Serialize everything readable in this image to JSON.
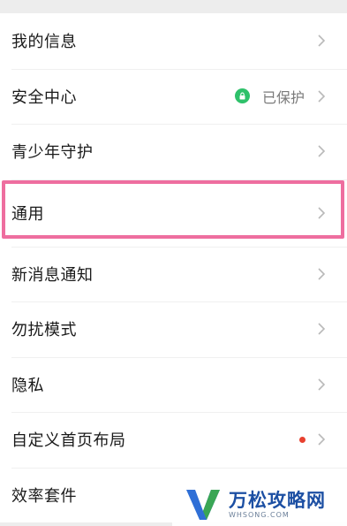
{
  "items": [
    {
      "label": "我的信息"
    },
    {
      "label": "安全中心",
      "status": "已保护",
      "status_color": "#2ec16a"
    },
    {
      "label": "青少年守护"
    },
    {
      "label": "通用",
      "highlighted": true
    },
    {
      "label": "新消息通知"
    },
    {
      "label": "勿扰模式"
    },
    {
      "label": "隐私"
    },
    {
      "label": "自定义首页布局",
      "badge": "red-dot"
    },
    {
      "label": "效率套件"
    }
  ],
  "icons": {
    "chevron": "chevron-right-icon",
    "security": "lock-icon"
  },
  "colors": {
    "highlight_border": "#ee6e9f",
    "status_green": "#2ec16a",
    "badge_red": "#e8412f",
    "background": "#ededed"
  },
  "watermark": {
    "name": "万松攻略网",
    "url": "WHSONG.COM"
  }
}
